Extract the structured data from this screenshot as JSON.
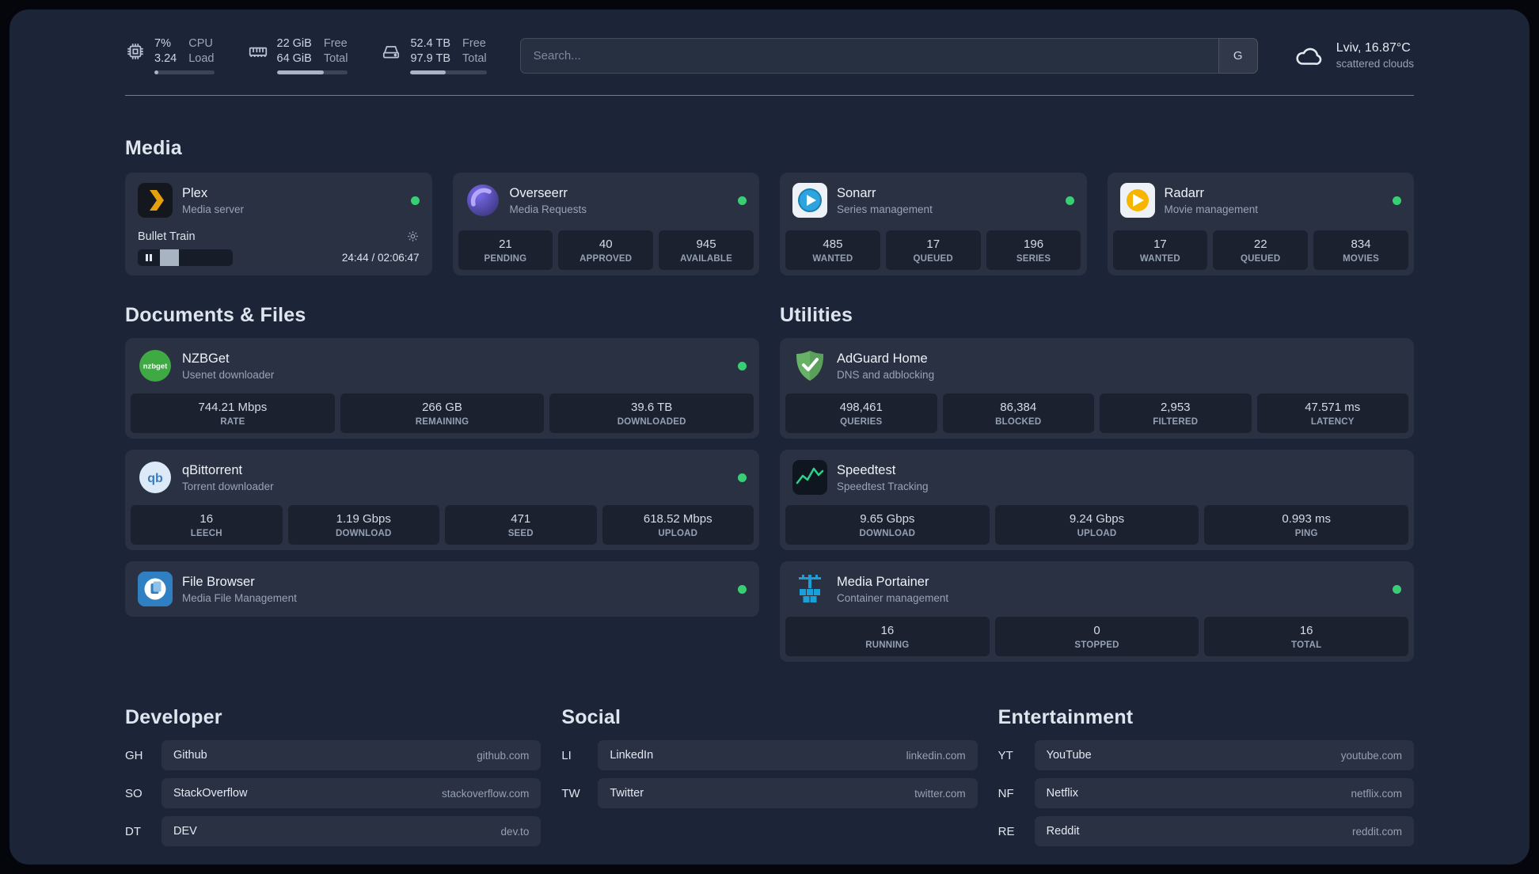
{
  "theme": {
    "status_green": "#38cf74"
  },
  "topbar": {
    "cpu": {
      "icon": "cpu-chip-icon",
      "value1": "7%",
      "label1": "CPU",
      "value2": "3.24",
      "label2": "Load",
      "progress_pct": 7
    },
    "memory": {
      "icon": "memory-icon",
      "value1": "22 GiB",
      "label1": "Free",
      "value2": "64 GiB",
      "label2": "Total",
      "progress_pct": 66
    },
    "disk": {
      "icon": "hard-drive-icon",
      "value1": "52.4 TB",
      "label1": "Free",
      "value2": "97.9 TB",
      "label2": "Total",
      "progress_pct": 46
    },
    "search": {
      "placeholder": "Search...",
      "provider_button": "G"
    },
    "weather": {
      "icon": "cloud-icon",
      "location": "Lviv, 16.87°C",
      "condition": "scattered clouds"
    }
  },
  "sections": {
    "media": {
      "title": "Media",
      "cards": [
        {
          "name": "Plex",
          "description": "Media server",
          "icon": "plex-icon",
          "status": "online",
          "now_playing": {
            "title": "Bullet Train",
            "time": "24:44 / 02:06:47",
            "progress_pct": 20
          }
        },
        {
          "name": "Overseerr",
          "description": "Media Requests",
          "icon": "overseerr-icon",
          "status": "online",
          "stats": [
            {
              "value": "21",
              "label": "PENDING"
            },
            {
              "value": "40",
              "label": "APPROVED"
            },
            {
              "value": "945",
              "label": "AVAILABLE"
            }
          ]
        },
        {
          "name": "Sonarr",
          "description": "Series management",
          "icon": "sonarr-icon",
          "status": "online",
          "stats": [
            {
              "value": "485",
              "label": "WANTED"
            },
            {
              "value": "17",
              "label": "QUEUED"
            },
            {
              "value": "196",
              "label": "SERIES"
            }
          ]
        },
        {
          "name": "Radarr",
          "description": "Movie management",
          "icon": "radarr-icon",
          "status": "online",
          "stats": [
            {
              "value": "17",
              "label": "WANTED"
            },
            {
              "value": "22",
              "label": "QUEUED"
            },
            {
              "value": "834",
              "label": "MOVIES"
            }
          ]
        }
      ]
    },
    "documents": {
      "title": "Documents & Files",
      "cards": [
        {
          "name": "NZBGet",
          "description": "Usenet downloader",
          "icon": "nzbget-icon",
          "status": "online",
          "stats": [
            {
              "value": "744.21 Mbps",
              "label": "RATE"
            },
            {
              "value": "266 GB",
              "label": "REMAINING"
            },
            {
              "value": "39.6 TB",
              "label": "DOWNLOADED"
            }
          ]
        },
        {
          "name": "qBittorrent",
          "description": "Torrent downloader",
          "icon": "qbittorrent-icon",
          "status": "online",
          "stats": [
            {
              "value": "16",
              "label": "LEECH"
            },
            {
              "value": "1.19 Gbps",
              "label": "DOWNLOAD"
            },
            {
              "value": "471",
              "label": "SEED"
            },
            {
              "value": "618.52 Mbps",
              "label": "UPLOAD"
            }
          ]
        },
        {
          "name": "File Browser",
          "description": "Media File Management",
          "icon": "filebrowser-icon",
          "status": "online",
          "stats": []
        }
      ]
    },
    "utilities": {
      "title": "Utilities",
      "cards": [
        {
          "name": "AdGuard Home",
          "description": "DNS and adblocking",
          "icon": "adguard-shield-icon",
          "stats": [
            {
              "value": "498,461",
              "label": "QUERIES"
            },
            {
              "value": "86,384",
              "label": "BLOCKED"
            },
            {
              "value": "2,953",
              "label": "FILTERED"
            },
            {
              "value": "47.571 ms",
              "label": "LATENCY"
            }
          ]
        },
        {
          "name": "Speedtest",
          "description": "Speedtest Tracking",
          "icon": "speedtest-graph-icon",
          "stats": [
            {
              "value": "9.65 Gbps",
              "label": "DOWNLOAD"
            },
            {
              "value": "9.24 Gbps",
              "label": "UPLOAD"
            },
            {
              "value": "0.993 ms",
              "label": "PING"
            }
          ]
        },
        {
          "name": "Media Portainer",
          "description": "Container management",
          "icon": "portainer-crane-icon",
          "status": "online",
          "stats": [
            {
              "value": "16",
              "label": "RUNNING"
            },
            {
              "value": "0",
              "label": "STOPPED"
            },
            {
              "value": "16",
              "label": "TOTAL"
            }
          ]
        }
      ]
    },
    "bookmarks": [
      {
        "title": "Developer",
        "links": [
          {
            "abbr": "GH",
            "name": "Github",
            "url": "github.com"
          },
          {
            "abbr": "SO",
            "name": "StackOverflow",
            "url": "stackoverflow.com"
          },
          {
            "abbr": "DT",
            "name": "DEV",
            "url": "dev.to"
          }
        ]
      },
      {
        "title": "Social",
        "links": [
          {
            "abbr": "LI",
            "name": "LinkedIn",
            "url": "linkedin.com"
          },
          {
            "abbr": "TW",
            "name": "Twitter",
            "url": "twitter.com"
          }
        ]
      },
      {
        "title": "Entertainment",
        "links": [
          {
            "abbr": "YT",
            "name": "YouTube",
            "url": "youtube.com"
          },
          {
            "abbr": "NF",
            "name": "Netflix",
            "url": "netflix.com"
          },
          {
            "abbr": "RE",
            "name": "Reddit",
            "url": "reddit.com"
          }
        ]
      }
    ]
  }
}
